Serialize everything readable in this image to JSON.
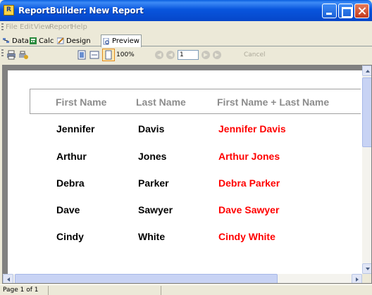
{
  "window": {
    "title": "ReportBuilder: New Report",
    "app_icon_letter": "R"
  },
  "menu": [
    "File",
    "Edit",
    "View",
    "Report",
    "Help"
  ],
  "tabs": [
    {
      "label": "Data",
      "icon": "data-icon"
    },
    {
      "label": "Calc",
      "icon": "calc-icon"
    },
    {
      "label": "Design",
      "icon": "design-icon"
    },
    {
      "label": "Preview",
      "icon": "preview-icon",
      "active": true
    }
  ],
  "toolbar": {
    "zoom": "100%",
    "page_number": "1",
    "cancel_label": "Cancel"
  },
  "report": {
    "headers": [
      "First Name",
      "Last Name",
      "First Name + Last Name"
    ],
    "rows": [
      {
        "first": "Jennifer",
        "last": "Davis",
        "full": "Jennifer Davis"
      },
      {
        "first": "Arthur",
        "last": "Jones",
        "full": "Arthur Jones"
      },
      {
        "first": "Debra",
        "last": "Parker",
        "full": "Debra Parker"
      },
      {
        "first": "Dave",
        "last": "Sawyer",
        "full": "Dave Sawyer"
      },
      {
        "first": "Cindy",
        "last": "White",
        "full": "Cindy White"
      }
    ]
  },
  "status": {
    "page_text": "Page 1 of 1"
  },
  "colors": {
    "titlebar": "#0855dd",
    "header_text": "#8c8c8c",
    "full_name_text": "#ff0000"
  }
}
